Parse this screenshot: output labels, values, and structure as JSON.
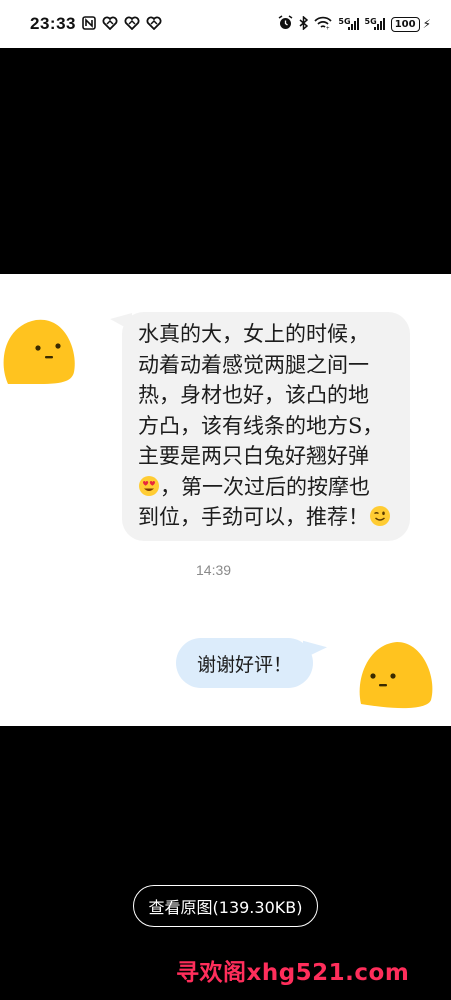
{
  "status_bar": {
    "time": "23:33",
    "icons_left": [
      "nfc-icon",
      "heart-icon",
      "heart-icon",
      "heart-icon"
    ],
    "icons_right": [
      "alarm-icon",
      "bluetooth-icon",
      "wifi-icon",
      "signal-5g-icon",
      "signal-5g-icon",
      "battery-icon",
      "charging-icon"
    ],
    "network_1": "5G",
    "network_2": "5G",
    "battery_level": "100"
  },
  "chat": {
    "incoming_message": {
      "lines": [
        "水真的大，女上的时候，",
        "动着动着感觉两腿之间一",
        "热，身材也好，该凸的地",
        "方凸，该有线条的地方S，",
        "主要是两只白兔好翘好弹",
        "，第一次过后的按摩也",
        "到位，手劲可以，推荐！"
      ],
      "emoji_line5": "heart-eyes-emoji",
      "emoji_line7": "wink-emoji"
    },
    "timestamp": "14:39",
    "outgoing_message": "谢谢好评！"
  },
  "viewer": {
    "view_original_label": "查看原图(139.30KB)"
  },
  "watermark": "寻欢阁xhg521.com",
  "colors": {
    "incoming_bubble": "#f2f2f2",
    "outgoing_bubble": "#dcecfb",
    "avatar_yellow": "#ffc31f",
    "watermark": "#ff2e5b"
  }
}
